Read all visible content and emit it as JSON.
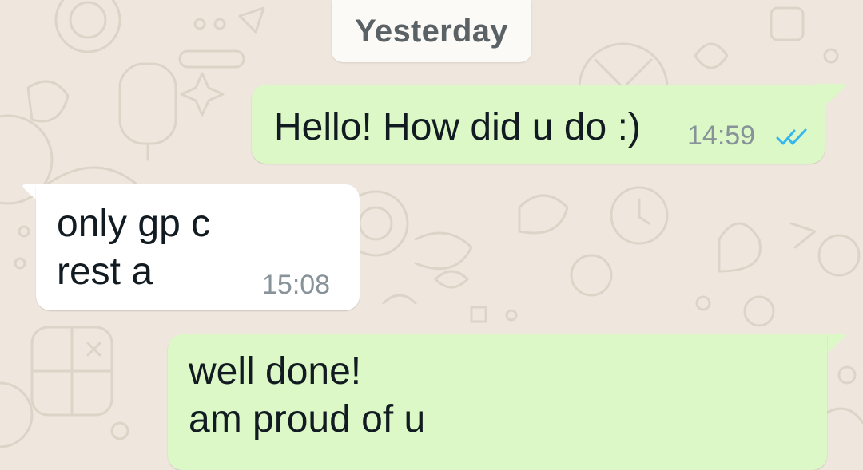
{
  "colors": {
    "wallpaper": "#efe7de",
    "outgoing_bubble": "#dcf8c6",
    "incoming_bubble": "#ffffff",
    "read_ticks": "#34b7f1"
  },
  "date_separator": "Yesterday",
  "messages": [
    {
      "direction": "outgoing",
      "text": "Hello! How did u do :)",
      "time": "14:59",
      "status_icon": "double-check-read-icon"
    },
    {
      "direction": "incoming",
      "text": "only gp c\nrest a",
      "time": "15:08"
    },
    {
      "direction": "outgoing",
      "text": "well done!\nam proud of u"
    }
  ]
}
